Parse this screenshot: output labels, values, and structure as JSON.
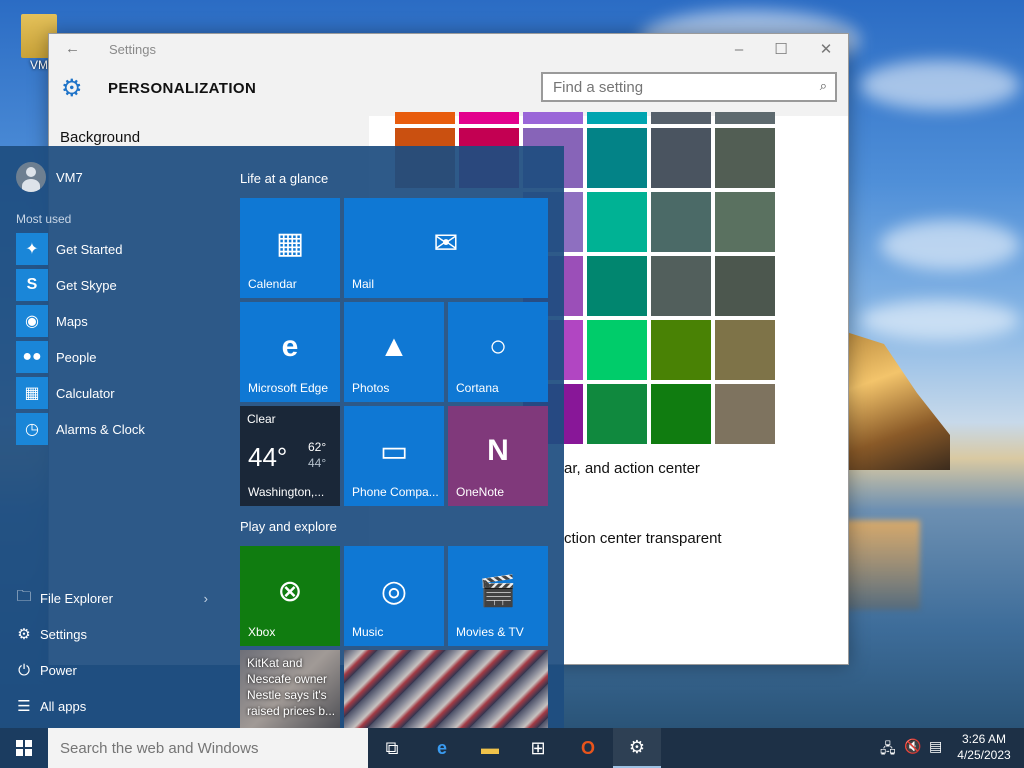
{
  "desktop": {
    "icon_label": "VM",
    "colors": {
      "accent": "#0f78d4",
      "start_bg": "#1e4e80",
      "taskbar_bg": "#1d3046"
    }
  },
  "settings": {
    "window_title": "Settings",
    "back_icon": "back-arrow-icon",
    "page_title": "PERSONALIZATION",
    "search_placeholder": "Find a setting",
    "nav_first_item": "Background",
    "color_rows": [
      [
        "#e85c0d",
        "#e3008c",
        "#9a66d8",
        "#00a5b0",
        "#56606b",
        "#5e6a6f"
      ],
      [
        "#ca5010",
        "#c30052",
        "#8764b8",
        "#038387",
        "#4a5460",
        "#525e54"
      ],
      [
        "",
        "",
        "#8e6fc0",
        "#00b294",
        "#4b6a67",
        "#5a7160"
      ],
      [
        "",
        "",
        "#9b4fb8",
        "#01866f",
        "#525f5c",
        "#4c574e"
      ],
      [
        "",
        "",
        "#b146c2",
        "#00cc6a",
        "#498205",
        "#7e7348"
      ],
      [
        "",
        "",
        "#881798",
        "#10893e",
        "#107c10",
        "#7e735f"
      ]
    ],
    "text_line_1": "ar, and action center",
    "text_line_2": "ction center transparent"
  },
  "start_menu": {
    "user_name": "VM7",
    "most_used_label": "Most used",
    "apps": [
      {
        "label": "Get Started",
        "icon": "lightbulb-icon",
        "glyph": "💡"
      },
      {
        "label": "Get Skype",
        "icon": "skype-icon",
        "glyph": "S"
      },
      {
        "label": "Maps",
        "icon": "maps-icon",
        "glyph": "◉"
      },
      {
        "label": "People",
        "icon": "people-icon",
        "glyph": "👥"
      },
      {
        "label": "Calculator",
        "icon": "calculator-icon",
        "glyph": "▦"
      },
      {
        "label": "Alarms & Clock",
        "icon": "alarm-clock-icon",
        "glyph": "⏰"
      }
    ],
    "bottom": {
      "file_explorer": "File Explorer",
      "settings": "Settings",
      "power": "Power",
      "all_apps": "All apps"
    },
    "groups": {
      "life": "Life at a glance",
      "play": "Play and explore"
    },
    "tiles": {
      "calendar": "Calendar",
      "mail": "Mail",
      "edge": "Microsoft Edge",
      "photos": "Photos",
      "cortana": "Cortana",
      "phone": "Phone Compa...",
      "onenote": "OneNote",
      "xbox": "Xbox",
      "music": "Music",
      "movies": "Movies & TV"
    },
    "weather": {
      "condition": "Clear",
      "temp": "44°",
      "high": "62°",
      "low": "44°",
      "location": "Washington,..."
    },
    "news_headline": "KitKat and Nescafe owner Nestle says it's raised prices b..."
  },
  "taskbar": {
    "search_placeholder": "Search the web and Windows",
    "time": "3:26 AM",
    "date": "4/25/2023"
  }
}
